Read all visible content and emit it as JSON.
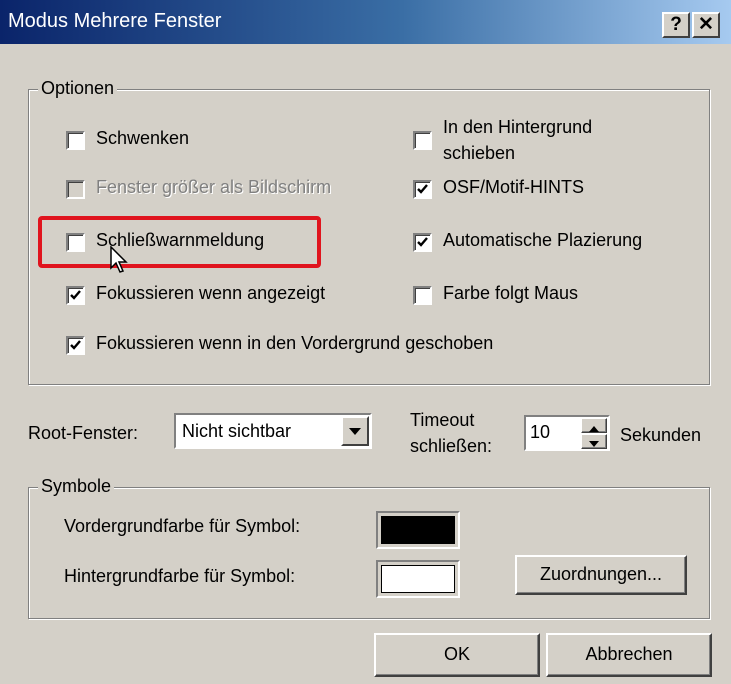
{
  "window": {
    "title": "Modus Mehrere Fenster",
    "help_label": "?",
    "close_label": "✕"
  },
  "options": {
    "legend": "Optionen",
    "schwenken": "Schwenken",
    "hintergrund_line1": "In den Hintergrund",
    "hintergrund_line2": "schieben",
    "fenster_groesser": "Fenster größer als Bildschirm",
    "osf_hints": "OSF/Motif-HINTS",
    "schliesswarnmeldung": "Schließwarnmeldung",
    "automatische_plazierung": "Automatische Plazierung",
    "fokus_angezeigt": "Fokussieren wenn angezeigt",
    "farbe_folgt_maus": "Farbe folgt Maus",
    "fokus_vordergrund": "Fokussieren wenn in den Vordergrund geschoben"
  },
  "root": {
    "label": "Root-Fenster:",
    "value": "Nicht sichtbar"
  },
  "timeout": {
    "label_line1": "Timeout",
    "label_line2": "schließen:",
    "value": "10",
    "unit": "Sekunden"
  },
  "symbols": {
    "legend": "Symbole",
    "fg_label": "Vordergrundfarbe für Symbol:",
    "bg_label": "Hintergrundfarbe für Symbol:",
    "fg_color": "#000000",
    "bg_color": "#ffffff",
    "assign_button": "Zuordnungen..."
  },
  "buttons": {
    "ok": "OK",
    "cancel": "Abbrechen"
  }
}
